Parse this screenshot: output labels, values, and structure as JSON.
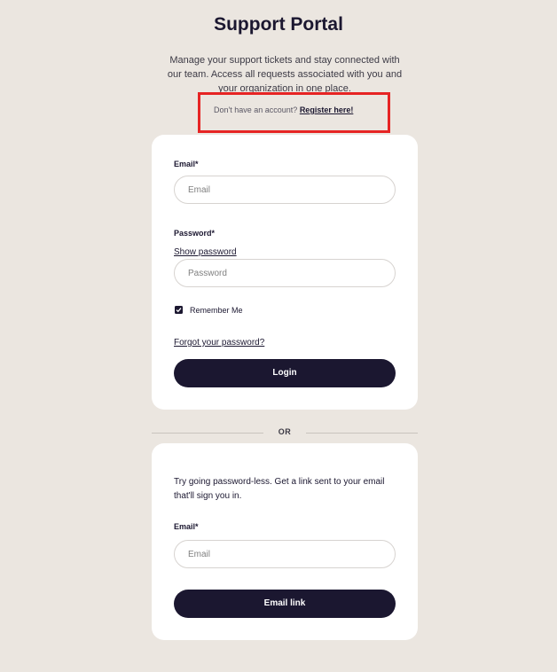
{
  "header": {
    "title": "Support Portal",
    "intro": "Manage your support tickets and stay connected with our team. Access all requests associated with you and your organization in one place."
  },
  "register": {
    "prompt": "Don't have an account?",
    "link_label": "Register here!"
  },
  "login_form": {
    "email_label": "Email*",
    "email_placeholder": "Email",
    "email_value": "",
    "password_label": "Password*",
    "show_password_label": "Show password",
    "password_placeholder": "Password",
    "password_value": "",
    "remember_me_label": "Remember Me",
    "remember_me_checked": true,
    "forgot_password_label": "Forgot your password?",
    "login_button_label": "Login"
  },
  "divider": {
    "label": "OR"
  },
  "passwordless_form": {
    "description": "Try going password-less. Get a link sent to your email that'll sign you in.",
    "email_label": "Email*",
    "email_placeholder": "Email",
    "email_value": "",
    "submit_label": "Email link"
  },
  "colors": {
    "background": "#ebe6e0",
    "card": "#ffffff",
    "primary": "#1b1730",
    "highlight": "#e62424"
  },
  "icons": {
    "checkbox_mark": "check-icon"
  }
}
